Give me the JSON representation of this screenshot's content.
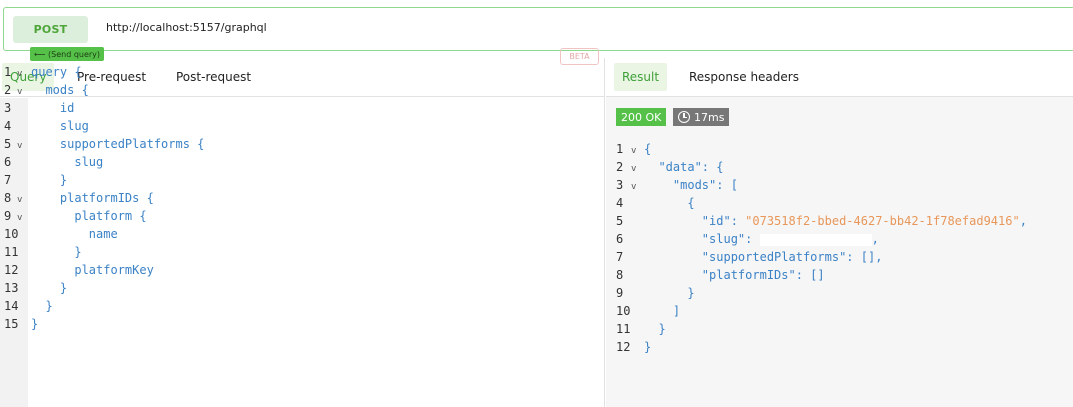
{
  "request": {
    "method": "POST",
    "url": "http://localhost:5157/graphql"
  },
  "left_tabs": {
    "query": "Query",
    "pre_request": "Pre-request",
    "post_request": "Post-request"
  },
  "editor": {
    "send_query_label": "⟵ (Send query)",
    "beta_label": "BETA",
    "lines": [
      {
        "n": "1",
        "fold": "v",
        "text": "query {"
      },
      {
        "n": "2",
        "fold": "v",
        "text": "  mods {"
      },
      {
        "n": "3",
        "fold": "",
        "text": "    id"
      },
      {
        "n": "4",
        "fold": "",
        "text": "    slug"
      },
      {
        "n": "5",
        "fold": "v",
        "text": "    supportedPlatforms {"
      },
      {
        "n": "6",
        "fold": "",
        "text": "      slug"
      },
      {
        "n": "7",
        "fold": "",
        "text": "    }"
      },
      {
        "n": "8",
        "fold": "v",
        "text": "    platformIDs {"
      },
      {
        "n": "9",
        "fold": "v",
        "text": "      platform {"
      },
      {
        "n": "10",
        "fold": "",
        "text": "        name"
      },
      {
        "n": "11",
        "fold": "",
        "text": "      }"
      },
      {
        "n": "12",
        "fold": "",
        "text": "      platformKey"
      },
      {
        "n": "13",
        "fold": "",
        "text": "    }"
      },
      {
        "n": "14",
        "fold": "",
        "text": "  }"
      },
      {
        "n": "15",
        "fold": "",
        "text": "}"
      }
    ]
  },
  "right_tabs": {
    "result": "Result",
    "response_headers": "Response headers"
  },
  "response": {
    "status": "200 OK",
    "time": "17ms",
    "lines": [
      {
        "n": "1",
        "fold": "v",
        "text": "{"
      },
      {
        "n": "2",
        "fold": "v",
        "text": "  \"data\": {"
      },
      {
        "n": "3",
        "fold": "v",
        "text": "    \"mods\": ["
      },
      {
        "n": "4",
        "fold": "",
        "text": "      {"
      },
      {
        "n": "5",
        "fold": "",
        "key": "        \"id\": ",
        "value": "\"073518f2-bbed-4627-bb42-1f78efad9416\"",
        "tail": ","
      },
      {
        "n": "6",
        "fold": "",
        "key": "        \"slug\": ",
        "redacted": true,
        "tail": ","
      },
      {
        "n": "7",
        "fold": "",
        "text": "        \"supportedPlatforms\": [],"
      },
      {
        "n": "8",
        "fold": "",
        "text": "        \"platformIDs\": []"
      },
      {
        "n": "9",
        "fold": "",
        "text": "      }"
      },
      {
        "n": "10",
        "fold": "",
        "text": "    ]"
      },
      {
        "n": "11",
        "fold": "",
        "text": "  }"
      },
      {
        "n": "12",
        "fold": "",
        "text": "}"
      }
    ]
  }
}
